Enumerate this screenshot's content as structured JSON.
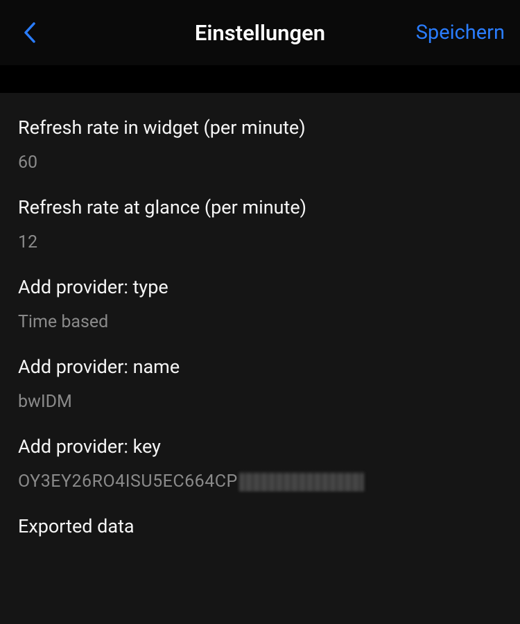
{
  "header": {
    "title": "Einstellungen",
    "save_label": "Speichern"
  },
  "rows": {
    "refresh_widget": {
      "label": "Refresh rate in widget (per minute)",
      "value": "60"
    },
    "refresh_glance": {
      "label": "Refresh rate at glance (per minute)",
      "value": "12"
    },
    "provider_type": {
      "label": "Add provider: type",
      "value": "Time based"
    },
    "provider_name": {
      "label": "Add provider: name",
      "value": "bwIDM"
    },
    "provider_key": {
      "label": "Add provider: key",
      "value_visible": "OY3EY26RO4ISU5EC664CP"
    },
    "exported": {
      "label": "Exported data"
    }
  }
}
